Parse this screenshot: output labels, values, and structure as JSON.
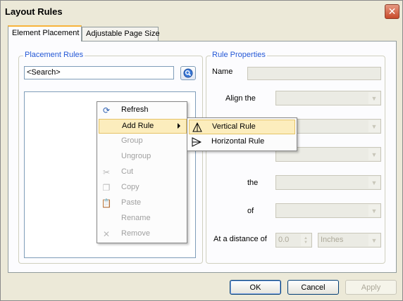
{
  "window": {
    "title": "Layout Rules",
    "close_label": "✕"
  },
  "tabs": [
    {
      "label": "Element Placement",
      "active": true
    },
    {
      "label": "Adjustable Page Size",
      "active": false
    }
  ],
  "placement_rules": {
    "title": "Placement Rules",
    "search_value": "<Search>"
  },
  "rule_properties": {
    "title": "Rule Properties",
    "name_label": "Name",
    "name_value": "",
    "align_label": "Align the",
    "the_label": "the",
    "of_label": "of",
    "distance_label": "At a distance of",
    "distance_value": "0.0",
    "units_value": "Inches"
  },
  "context_menu": {
    "items": [
      {
        "label": "Refresh",
        "icon": "refresh-icon",
        "enabled": true
      },
      {
        "label": "Add Rule",
        "icon": "",
        "enabled": true,
        "has_submenu": true,
        "highlighted": true
      },
      {
        "label": "Group",
        "icon": "",
        "enabled": false
      },
      {
        "label": "Ungroup",
        "icon": "",
        "enabled": false
      },
      {
        "label": "Cut",
        "icon": "scissors-icon",
        "enabled": false
      },
      {
        "label": "Copy",
        "icon": "copy-icon",
        "enabled": false
      },
      {
        "label": "Paste",
        "icon": "paste-icon",
        "enabled": false
      },
      {
        "label": "Rename",
        "icon": "",
        "enabled": false
      },
      {
        "label": "Remove",
        "icon": "remove-icon",
        "enabled": false
      }
    ]
  },
  "submenu": {
    "items": [
      {
        "label": "Vertical Rule",
        "icon": "vertical-rule-icon",
        "highlighted": true
      },
      {
        "label": "Horizontal Rule",
        "icon": "horizontal-rule-icon",
        "highlighted": false
      }
    ]
  },
  "buttons": {
    "ok": "OK",
    "cancel": "Cancel",
    "apply": "Apply"
  },
  "colors": {
    "group_title": "#2458d6",
    "menu_highlight": "#fcedbd",
    "tab_accent": "#f8b33b"
  }
}
